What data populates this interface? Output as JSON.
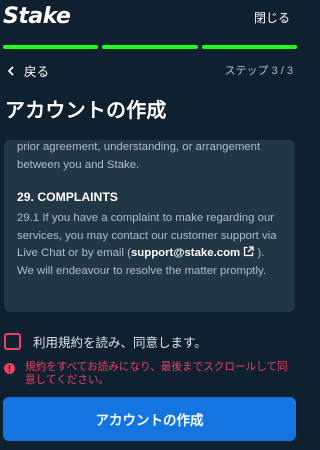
{
  "header": {
    "logo_text": "Stake",
    "close_label": "閉じる"
  },
  "progress": {
    "total_steps": 3,
    "completed_steps": 3,
    "color": "#1fff20"
  },
  "nav": {
    "back_label": "戻る",
    "step_indicator": "ステップ 3 / 3"
  },
  "page": {
    "title": "アカウントの作成"
  },
  "terms": {
    "intro_text": "prior agreement, understanding, or arrangement between you and Stake.",
    "section_heading": "29. COMPLAINTS",
    "body_before_email": "29.1 If you have a complaint to make regarding our services, you may contact our customer support via Live Chat or by email (",
    "email": "support@stake.com",
    "body_after_email": " ). We will endeavour to resolve the matter promptly."
  },
  "agreement": {
    "checkbox_label": "利用規約を読み、同意します。",
    "checked": false,
    "error_message": "規約をすべてお読みになり、最後までスクロールして同意してください。"
  },
  "submit": {
    "label": "アカウントの作成"
  },
  "colors": {
    "background": "#0f212e",
    "panel": "#213743",
    "primary_button": "#1475e1",
    "error": "#ed4163",
    "muted_text": "#b1bad3"
  }
}
